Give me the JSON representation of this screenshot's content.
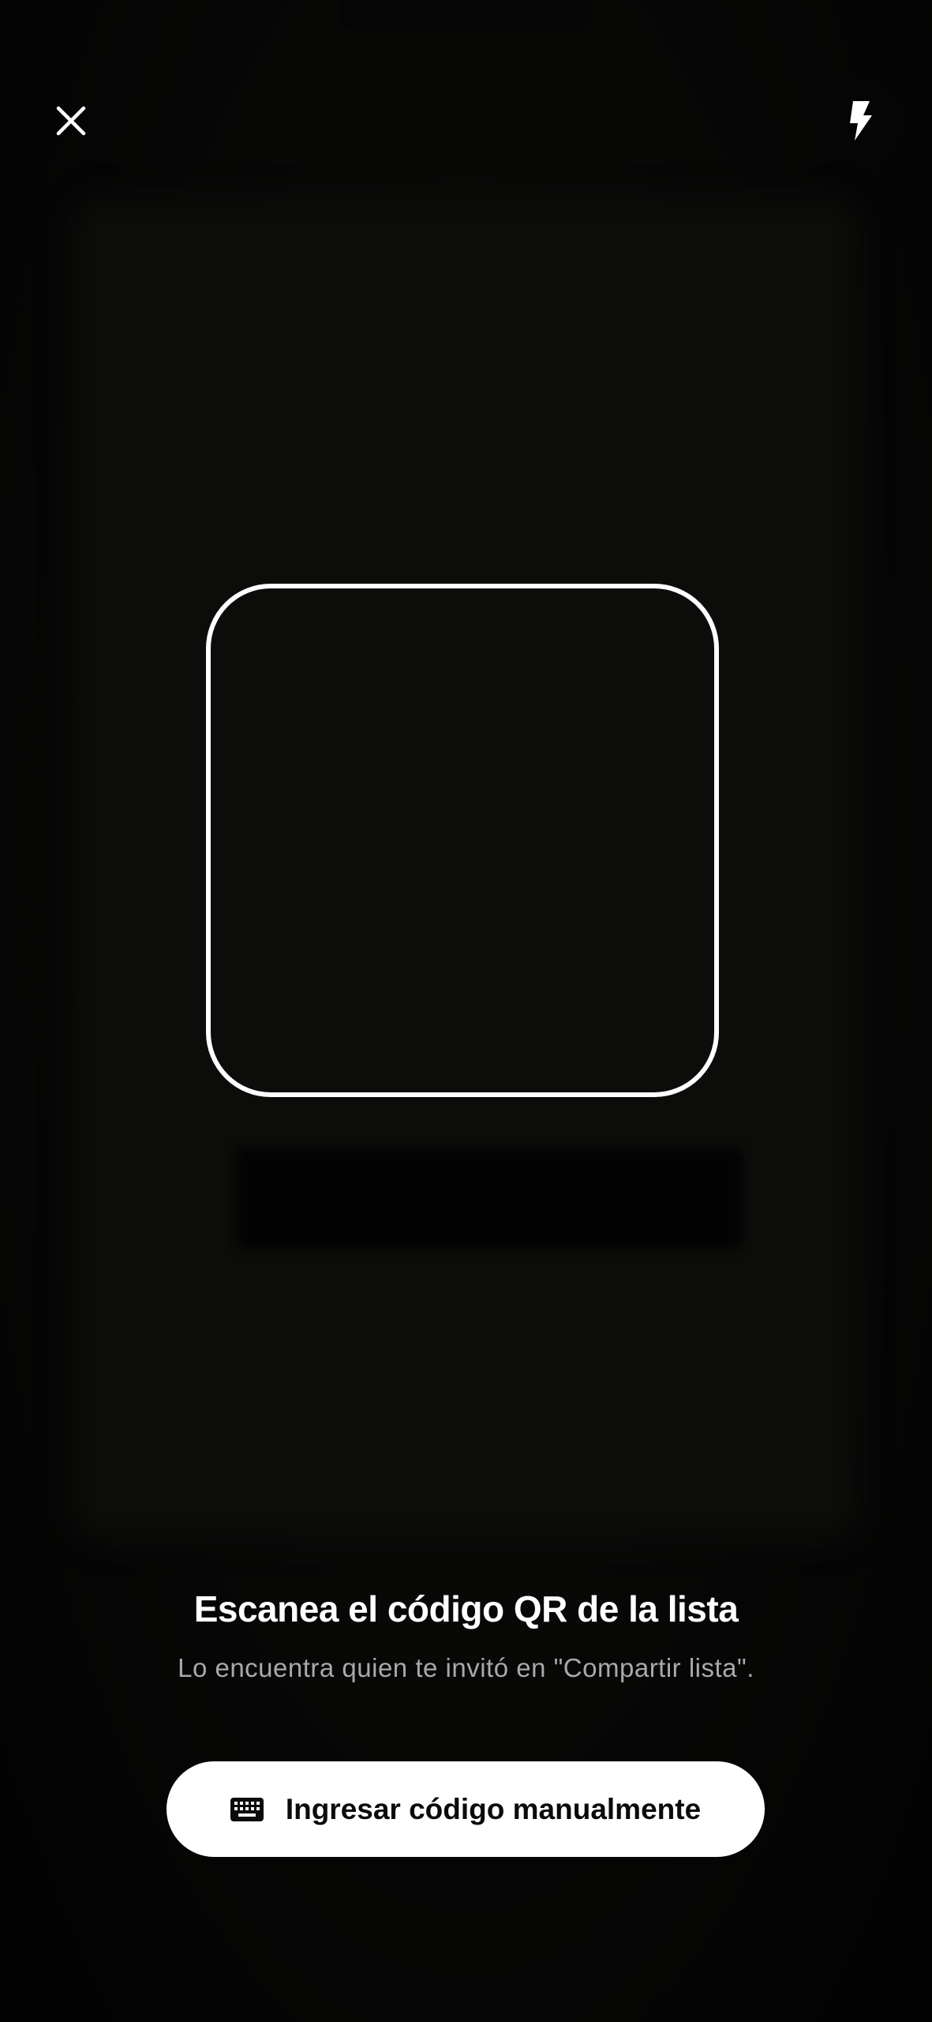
{
  "header": {
    "close_icon": "close-icon",
    "flash_icon": "flash-icon"
  },
  "scanner": {
    "frame_color": "#ffffff"
  },
  "instructions": {
    "title": "Escanea el código QR de la lista",
    "subtitle": "Lo encuentra quien te invitó en \"Compartir lista\"."
  },
  "manual_entry": {
    "icon": "keyboard-icon",
    "label": "Ingresar código manualmente"
  },
  "colors": {
    "background": "#000000",
    "text_primary": "#ffffff",
    "text_secondary": "#a9a9a9",
    "button_background": "#ffffff",
    "button_text": "#0b0b0b"
  }
}
